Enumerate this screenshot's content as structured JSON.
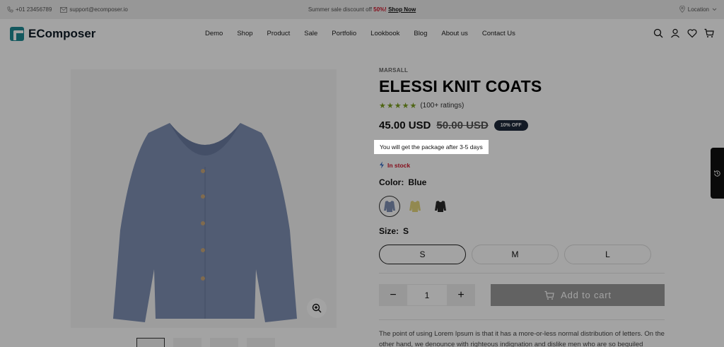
{
  "topbar": {
    "phone": "+01 23456789",
    "email": "support@ecomposer.io",
    "promo_prefix": "Summer sale discount off ",
    "promo_percent": "50%!",
    "promo_link": "Shop Now",
    "location": "Location"
  },
  "header": {
    "logo": "EComposer",
    "nav": [
      "Demo",
      "Shop",
      "Product",
      "Sale",
      "Portfolio",
      "Lookbook",
      "Blog",
      "About us",
      "Contact Us"
    ],
    "icons": [
      "search-icon",
      "account-icon",
      "wishlist-icon",
      "cart-icon"
    ]
  },
  "product": {
    "brand": "MARSALL",
    "title": "ELESSI KNIT COATS",
    "stars": "★★★★★",
    "ratings": "(100+ ratings)",
    "price": "45.00 USD",
    "compare_price": "50.00 USD",
    "badge": "10% OFF",
    "delivery_tooltip": "You will get the package after 3-5 days",
    "stock": "In stock",
    "color_label": "Color:",
    "color_value": "Blue",
    "swatch_colors": [
      "#7f90b4",
      "#e5d77e",
      "#2a2a2a"
    ],
    "size_label": "Size:",
    "size_value": "S",
    "sizes": [
      "S",
      "M",
      "L"
    ],
    "qty_minus": "−",
    "qty_value": "1",
    "qty_plus": "+",
    "add_to_cart": "Add to cart",
    "description": "The point of using Lorem Ipsum is that it has a more-or-less normal distribution of letters. On the other hand, we denounce with righteous indignation and dislike men who are so beguiled"
  },
  "colors": {
    "accent": "#1f8a94",
    "sale": "#d0152b",
    "badge": "#1e2a3a",
    "stars": "#7a9e1f"
  }
}
